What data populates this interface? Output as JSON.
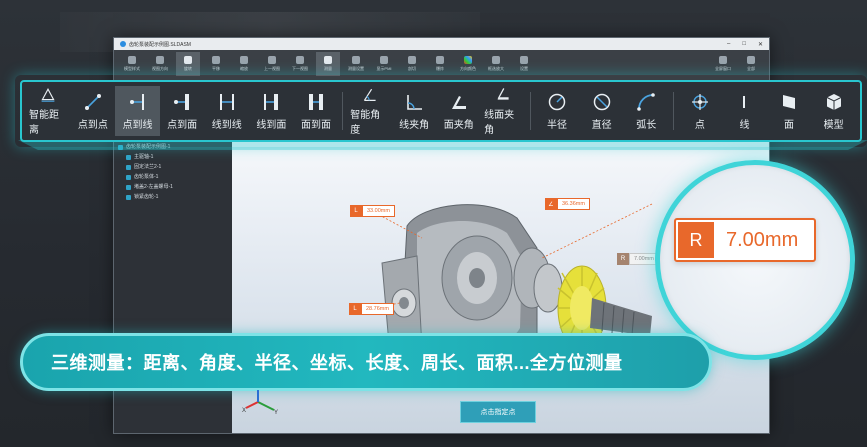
{
  "window": {
    "title": "齿轮泵装配示例图.SLDASM",
    "top_tools": [
      {
        "label": "模型样式",
        "active": false
      },
      {
        "label": "视图方向",
        "active": false
      },
      {
        "label": "旋转",
        "active": true
      },
      {
        "label": "平移",
        "active": false
      },
      {
        "label": "缩放",
        "active": false
      },
      {
        "label": "上一视图",
        "active": false
      },
      {
        "label": "下一视图",
        "active": false
      },
      {
        "label": "测量",
        "active": true
      },
      {
        "label": "测量设置",
        "active": false
      },
      {
        "label": "显示PMI",
        "active": false
      },
      {
        "label": "剖切",
        "active": false
      },
      {
        "label": "爆炸",
        "active": false
      },
      {
        "label": "方向颜色",
        "active": false
      },
      {
        "label": "框选放大",
        "active": false
      },
      {
        "label": "设置",
        "active": false
      }
    ],
    "right_tools": [
      "全屏窗口",
      "全部"
    ]
  },
  "tree": [
    "齿轮泵装配示例图-1",
    "主驱轴-1",
    "固定法兰2-1",
    "齿轮泵体-1",
    "堵盖2-左盖螺母-1",
    "锁紧齿轮-1"
  ],
  "measure_toolbar": [
    {
      "label": "智能距离",
      "icon": "smart-distance-icon",
      "active": false
    },
    {
      "label": "点到点",
      "icon": "point-to-point-icon",
      "active": false
    },
    {
      "label": "点到线",
      "icon": "point-to-line-icon",
      "active": true
    },
    {
      "label": "点到面",
      "icon": "point-to-face-icon",
      "active": false
    },
    {
      "label": "线到线",
      "icon": "line-to-line-icon",
      "active": false
    },
    {
      "label": "线到面",
      "icon": "line-to-face-icon",
      "active": false
    },
    {
      "label": "面到面",
      "icon": "face-to-face-icon",
      "active": false
    },
    {
      "label": "智能角度",
      "icon": "smart-angle-icon",
      "active": false
    },
    {
      "label": "线夹角",
      "icon": "line-angle-icon",
      "active": false
    },
    {
      "label": "面夹角",
      "icon": "face-angle-icon",
      "active": false
    },
    {
      "label": "线面夹角",
      "icon": "line-face-angle-icon",
      "active": false
    },
    {
      "label": "半径",
      "icon": "radius-icon",
      "active": false
    },
    {
      "label": "直径",
      "icon": "diameter-icon",
      "active": false
    },
    {
      "label": "弧长",
      "icon": "arc-length-icon",
      "active": false
    },
    {
      "label": "点",
      "icon": "point-icon",
      "active": false
    },
    {
      "label": "线",
      "icon": "line-icon",
      "active": false
    },
    {
      "label": "面",
      "icon": "face-icon",
      "active": false
    },
    {
      "label": "模型",
      "icon": "model-icon",
      "active": false
    }
  ],
  "measurements": [
    {
      "tag": "L",
      "value": "33.00mm"
    },
    {
      "tag": "∠",
      "value": "36.36mm"
    },
    {
      "tag": "L",
      "value": "28.76mm"
    },
    {
      "tag": "R",
      "value": "7.00mm"
    }
  ],
  "zoom_callout": {
    "tag": "R",
    "value": "7.00mm"
  },
  "banner": "三维测量：距离、角度、半径、坐标、长度、周长、面积...全方位测量",
  "pick_button": "点击指定点",
  "axes": {
    "x": "X",
    "y": "Y",
    "z": "Z"
  },
  "colors": {
    "accent": "#29c6cf",
    "measure": "#e8682b",
    "banner": "#22b8bf",
    "gear": "#e6e03a"
  }
}
